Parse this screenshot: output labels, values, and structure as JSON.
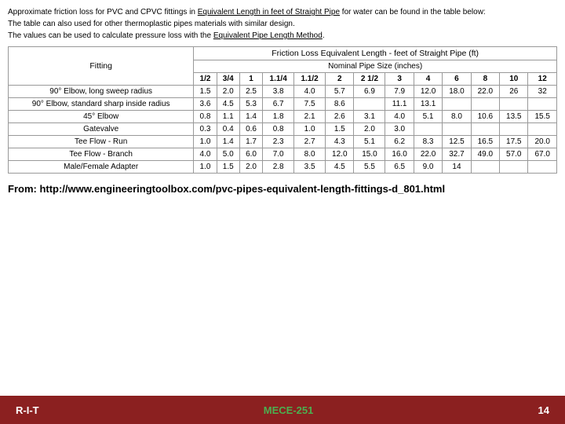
{
  "intro": {
    "line1": "Approximate friction loss for PVC and CPVC fittings in Equivalent Length in feet of Straight Pipe for water can be found in the table below:",
    "line2": "The table can also used for other thermoplastic pipes materials with similar design.",
    "line3": "The values can be used to calculate pressure loss with the Equivalent Pipe Length Method.",
    "link1": "Equivalent Length in feet of Straight Pipe",
    "link2": "Equivalent Pipe Length Method"
  },
  "table": {
    "header1": "Friction Loss Equivalent Length - feet of Straight Pipe (ft)",
    "header2": "Nominal Pipe Size (inches)",
    "fitting_label": "Fitting",
    "col_headers": [
      "1/2",
      "3/4",
      "1",
      "1.1/4",
      "1.1/2",
      "2",
      "2 1/2",
      "3",
      "4",
      "6",
      "8",
      "10",
      "12"
    ],
    "rows": [
      {
        "fitting": "90° Elbow, long sweep radius",
        "values": [
          "1.5",
          "2.0",
          "2.5",
          "3.8",
          "4.0",
          "5.7",
          "6.9",
          "7.9",
          "12.0",
          "18.0",
          "22.0",
          "26",
          "32"
        ]
      },
      {
        "fitting": "90° Elbow, standard sharp inside radius",
        "values": [
          "3.6",
          "4.5",
          "5.3",
          "6.7",
          "7.5",
          "8.6",
          "",
          "11.1",
          "13.1",
          "",
          "",
          "",
          ""
        ]
      },
      {
        "fitting": "45° Elbow",
        "values": [
          "0.8",
          "1.1",
          "1.4",
          "1.8",
          "2.1",
          "2.6",
          "3.1",
          "4.0",
          "5.1",
          "8.0",
          "10.6",
          "13.5",
          "15.5"
        ]
      },
      {
        "fitting": "Gatevalve",
        "values": [
          "0.3",
          "0.4",
          "0.6",
          "0.8",
          "1.0",
          "1.5",
          "2.0",
          "3.0",
          "",
          "",
          "",
          "",
          ""
        ]
      },
      {
        "fitting": "Tee Flow - Run",
        "values": [
          "1.0",
          "1.4",
          "1.7",
          "2.3",
          "2.7",
          "4.3",
          "5.1",
          "6.2",
          "8.3",
          "12.5",
          "16.5",
          "17.5",
          "20.0"
        ]
      },
      {
        "fitting": "Tee Flow - Branch",
        "values": [
          "4.0",
          "5.0",
          "6.0",
          "7.0",
          "8.0",
          "12.0",
          "15.0",
          "16.0",
          "22.0",
          "32.7",
          "49.0",
          "57.0",
          "67.0"
        ]
      },
      {
        "fitting": "Male/Female Adapter",
        "values": [
          "1.0",
          "1.5",
          "2.0",
          "2.8",
          "3.5",
          "4.5",
          "5.5",
          "6.5",
          "9.0",
          "14",
          "",
          "",
          ""
        ]
      }
    ]
  },
  "from_link": {
    "text": "From: http://www.engineeringtoolbox.com/pvc-pipes-equivalent-length-fittings-d_801.html"
  },
  "footer": {
    "left": "R-I-T",
    "center": "MECE-251",
    "right": "14"
  }
}
